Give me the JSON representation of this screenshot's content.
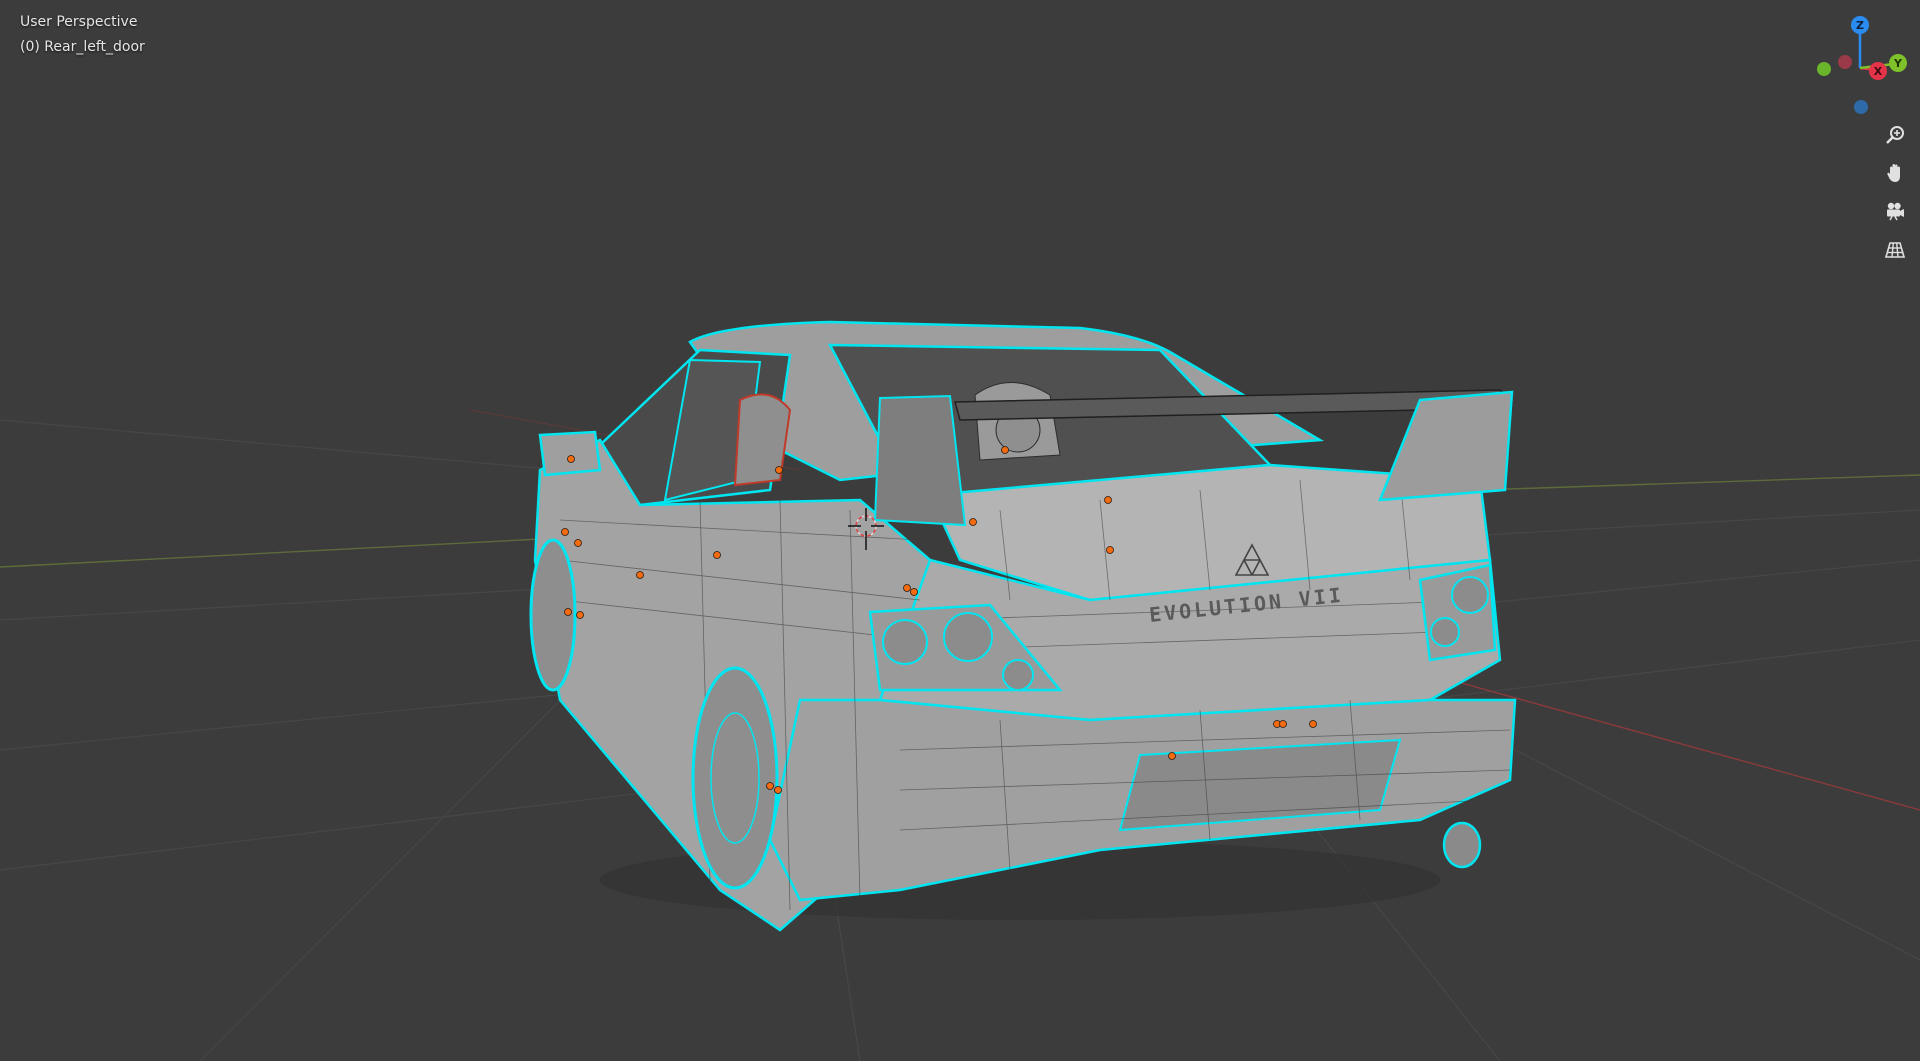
{
  "viewport": {
    "view_name": "User Perspective",
    "active_object": "(0) Rear_left_door",
    "background_color": "#3c3c3c"
  },
  "scene": {
    "model_color": "#a9a9a9",
    "selection_outline_color": "#00e5f0",
    "origin_dot_color": "#f26b10",
    "badge_text": "EVOLUTION VII"
  },
  "gizmo": {
    "z_label": "Z",
    "x_label": "X",
    "y_label": "Y",
    "x_color": "#e5344a",
    "y_color": "#7ec12a",
    "z_color": "#2a8bf0"
  },
  "nav_controls": [
    {
      "name": "zoom",
      "icon": "magnifier-icon"
    },
    {
      "name": "pan",
      "icon": "hand-icon"
    },
    {
      "name": "camera",
      "icon": "camera-icon"
    },
    {
      "name": "ortho",
      "icon": "grid-icon"
    }
  ]
}
